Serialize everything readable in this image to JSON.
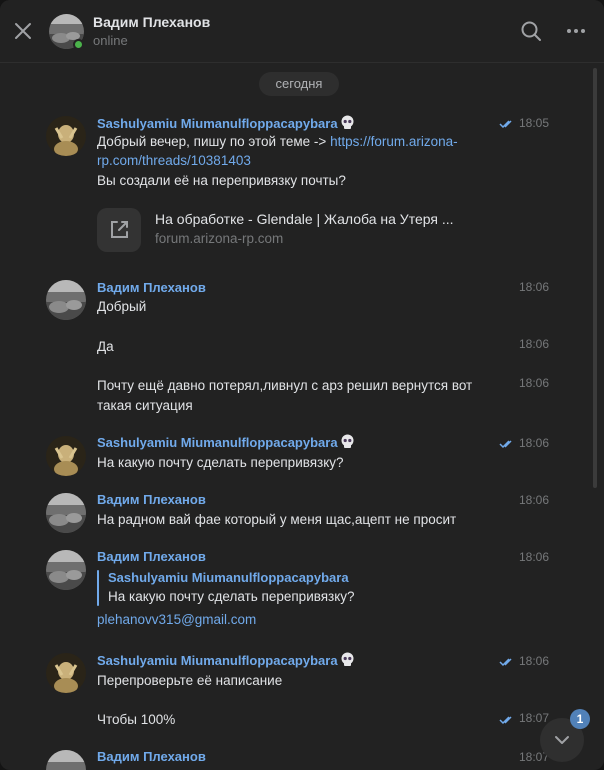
{
  "header": {
    "name": "Вадим Плеханов",
    "status": "online"
  },
  "chat": {
    "date_label": "сегодня",
    "messages": [
      {
        "author": "Sashulyamiu Miumanulfloppacapybara",
        "time": "18:05",
        "line1_prefix": "Добрый вечер, пишу по этой теме -> ",
        "link_part1": "https://forum.arizona-",
        "link_part2": "rp.com/threads/10381403",
        "line3": "Вы создали её на перепривязку почты?",
        "card_title": "На обработке - Glendale | Жалоба на Утеря ...",
        "card_domain": "forum.arizona-rp.com"
      },
      {
        "author": "Вадим Плеханов",
        "time": "18:06",
        "text": "Добрый"
      },
      {
        "time": "18:06",
        "text": "Да"
      },
      {
        "time": "18:06",
        "line1": "Почту ещё давно потерял,ливнул с арз решил вернутся вот",
        "line2": "такая ситуация"
      },
      {
        "author": "Sashulyamiu Miumanulfloppacapybara",
        "time": "18:06",
        "text": "На какую почту сделать перепривязку?"
      },
      {
        "author": "Вадим Плеханов",
        "time": "18:06",
        "text": "На радном вай фае который у меня щас,ацепт не просит"
      },
      {
        "author": "Вадим Плеханов",
        "time": "18:06",
        "quote_author": "Sashulyamiu Miumanulfloppacapybara",
        "quote_text": "На какую почту сделать перепривязку?",
        "email": "plehanovv315@gmail.com"
      },
      {
        "author": "Sashulyamiu Miumanulfloppacapybara",
        "time": "18:06",
        "text": "Перепроверьте её написание"
      },
      {
        "time": "18:07",
        "text": "Чтобы 100%"
      },
      {
        "author": "Вадим Плеханов",
        "time": "18:07"
      }
    ]
  },
  "scroll_down": {
    "unread_count": "1"
  },
  "icons": {
    "close": "close-icon",
    "search": "search-icon",
    "more": "more-icon",
    "read": "double-check-icon",
    "external": "external-link-icon",
    "skull": "skull-emoji",
    "scroll": "chevron-down-icon"
  },
  "colors": {
    "background": "#222222",
    "accent": "#71aaeb",
    "online": "#4bb34b",
    "badge": "#5181b8",
    "muted": "#76787a"
  }
}
